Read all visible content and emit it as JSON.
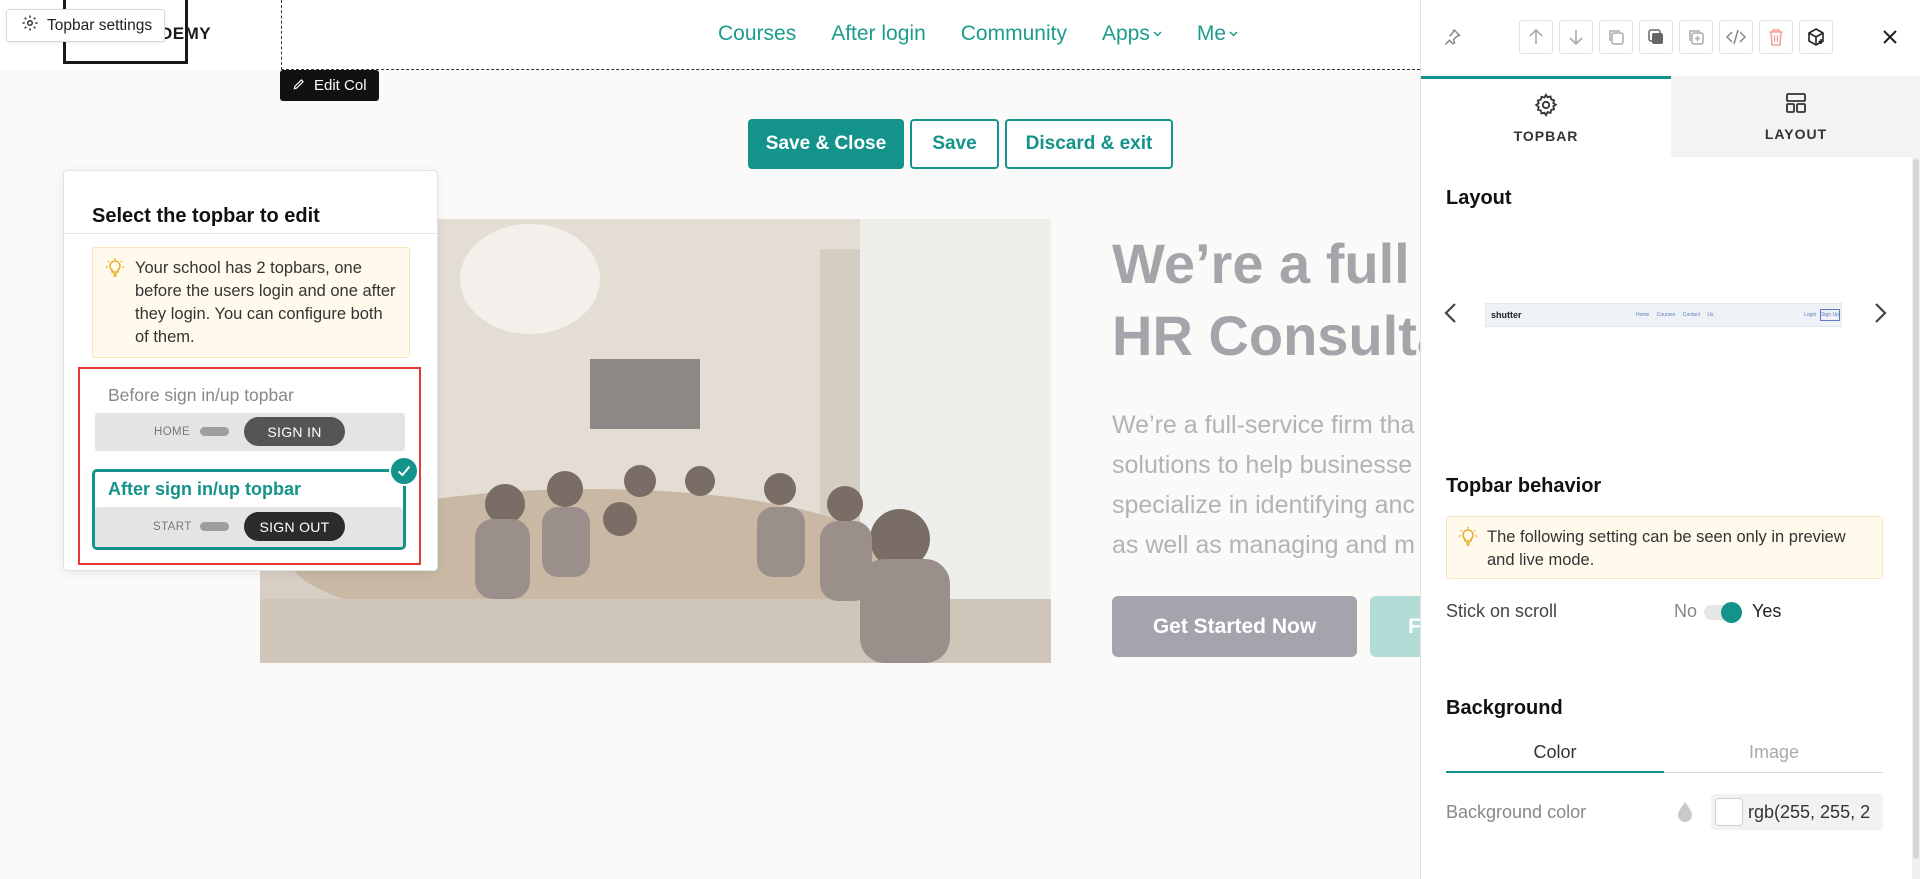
{
  "topbar": {
    "settings_label": "Topbar settings",
    "logo_text": "DEMY",
    "nav": [
      {
        "label": "Courses"
      },
      {
        "label": "After login"
      },
      {
        "label": "Community"
      },
      {
        "label": "Apps"
      },
      {
        "label": "Me"
      }
    ],
    "edit_col_label": "Edit Col"
  },
  "actions": {
    "save_close": "Save & Close",
    "save": "Save",
    "discard": "Discard & exit"
  },
  "hero": {
    "title_line1": "We’re a full",
    "title_line2": "HR Consulta",
    "text_lines": [
      "We’re a full-service firm tha",
      "solutions to help businesse",
      "specialize in identifying anc",
      "as well as managing and m"
    ],
    "cta_primary": "Get Started Now",
    "cta_secondary": "F"
  },
  "picker": {
    "title": "Select the topbar to edit",
    "tip": "Your school has 2 topbars, one before the users login and one after they login. You can configure both of them.",
    "before": {
      "label": "Before sign in/up topbar",
      "preview_left": "HOME",
      "preview_button": "SIGN IN"
    },
    "after": {
      "label": "After sign in/up topbar",
      "preview_left": "START",
      "preview_button": "SIGN OUT",
      "selected": true
    }
  },
  "panel": {
    "tabs": [
      {
        "label": "TOPBAR",
        "icon": "gear-icon",
        "active": true
      },
      {
        "label": "LAYOUT",
        "icon": "layout-icon",
        "active": false
      }
    ],
    "layout": {
      "title": "Layout",
      "thumb_logo": "shutter",
      "thumb_nav": "Home Courses Contact Us",
      "thumb_login": "Login",
      "thumb_signup": "Sign Up"
    },
    "behavior": {
      "title": "Topbar behavior",
      "note": "The following setting can be seen only in preview and live mode.",
      "stick_label": "Stick on scroll",
      "no": "No",
      "yes": "Yes",
      "stick_value": true
    },
    "background": {
      "title": "Background",
      "tabs": [
        "Color",
        "Image"
      ],
      "color_label": "Background color",
      "color_value": "rgb(255, 255, 2"
    }
  },
  "colors": {
    "accent": "#14938a",
    "highlight": "#e53935",
    "tip_bg": "#fffaeb"
  }
}
